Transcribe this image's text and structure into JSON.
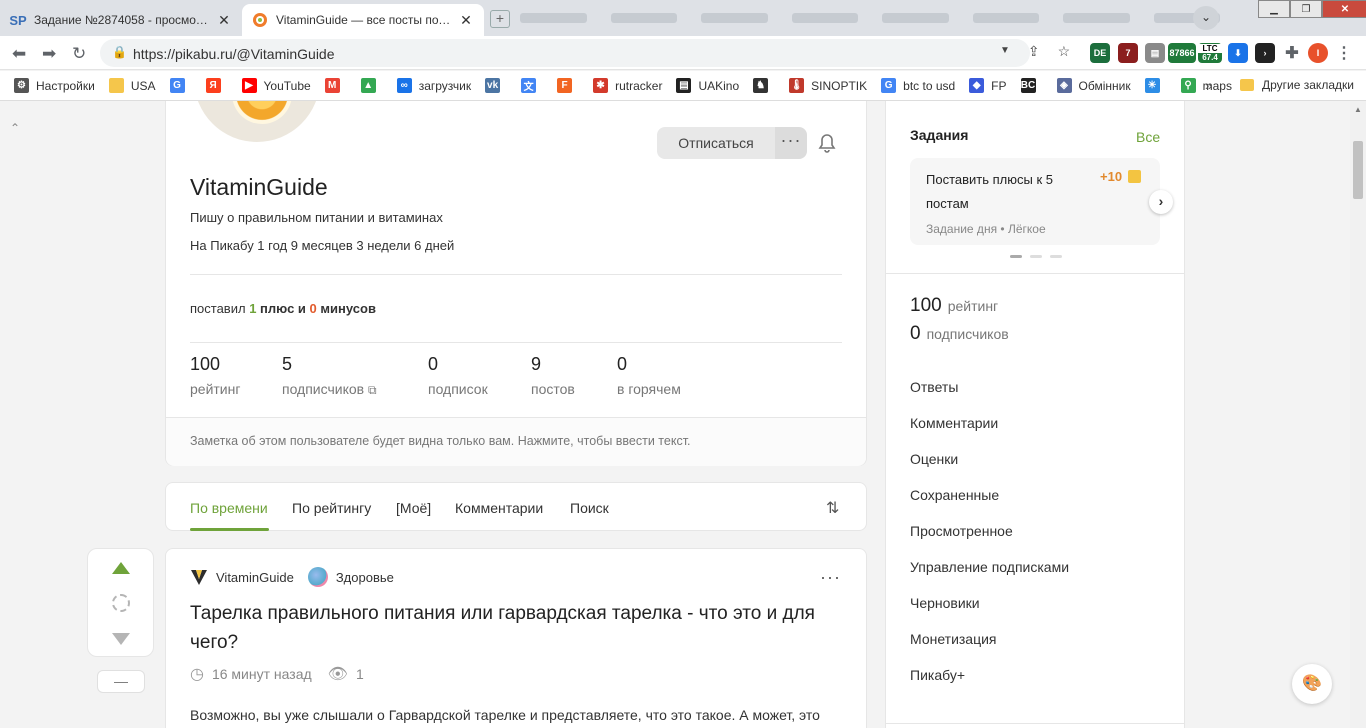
{
  "browser": {
    "tabs": [
      {
        "favicon": "SP",
        "title": "Задание №2874058 - просмотр з"
      },
      {
        "favicon": "pikabu-icon",
        "title": "VitaminGuide — все посты польз"
      }
    ],
    "url": "https://pikabu.ru/@VitaminGuide",
    "extensions": {
      "ltc": "LTC",
      "ltc_value": "67.4",
      "btc_value": "87866"
    },
    "profile_initial": "I",
    "bookmarks": [
      {
        "label": "Настройки",
        "icon": "gear-icon",
        "color": "#555555"
      },
      {
        "label": "USA",
        "icon": "folder-icon",
        "color": "#f5c64b"
      },
      {
        "label": "",
        "icon": "google-icon",
        "color": "#4285f4"
      },
      {
        "label": "",
        "icon": "yandex-icon",
        "color": "#fc3f1d"
      },
      {
        "label": "YouTube",
        "icon": "youtube-icon",
        "color": "#ff0000"
      },
      {
        "label": "",
        "icon": "gmail-icon",
        "color": "#ea4335"
      },
      {
        "label": "",
        "icon": "drive-icon",
        "color": "#34a853"
      },
      {
        "label": "загрузчик",
        "icon": "loop-icon",
        "color": "#1a73e8"
      },
      {
        "label": "",
        "icon": "vk-icon",
        "color": "#4c75a3"
      },
      {
        "label": "",
        "icon": "translate-icon",
        "color": "#4285f4"
      },
      {
        "label": "",
        "icon": "f-icon",
        "color": "#f26522"
      },
      {
        "label": "rutracker",
        "icon": "rutracker-icon",
        "color": "#d33a2c"
      },
      {
        "label": "UAKino",
        "icon": "uakino-icon",
        "color": "#222222"
      },
      {
        "label": "",
        "icon": "chess-icon",
        "color": "#333333"
      },
      {
        "label": "SINOPTIK",
        "icon": "thermometer-icon",
        "color": "#c0392b"
      },
      {
        "label": "btc to usd",
        "icon": "google-icon",
        "color": "#4285f4"
      },
      {
        "label": "FP",
        "icon": "fp-icon",
        "color": "#3b5bdb"
      },
      {
        "label": "",
        "icon": "bc-icon",
        "color": "#222222"
      },
      {
        "label": "Обмінник",
        "icon": "exchange-icon",
        "color": "#5a6b9c"
      },
      {
        "label": "",
        "icon": "snowflake-icon",
        "color": "#2d8de6"
      },
      {
        "label": "maps",
        "icon": "maps-icon",
        "color": "#34a853"
      }
    ],
    "bookmarks_more": "»",
    "other_bookmarks": "Другие закладки"
  },
  "profile": {
    "unsubscribe_label": "Отписаться",
    "name": "VitaminGuide",
    "description": "Пишу о правильном питании и витаминах",
    "joined": "На Пикабу 1 год 9 месяцев 3 недели 6 дней",
    "votes": {
      "prefix": "поставил",
      "plus_count": "1",
      "plus_label": "плюс и",
      "minus_count": "0",
      "minus_label": "минусов"
    },
    "stats": [
      {
        "value": "100",
        "label": "рейтинг"
      },
      {
        "value": "5",
        "label": "подписчиков"
      },
      {
        "value": "0",
        "label": "подписок"
      },
      {
        "value": "9",
        "label": "постов"
      },
      {
        "value": "0",
        "label": "в горячем"
      }
    ],
    "note": "Заметка об этом пользователе будет видна только вам. Нажмите, чтобы ввести текст."
  },
  "post_tabs": [
    {
      "label": "По времени",
      "active": true
    },
    {
      "label": "По рейтингу",
      "active": false
    },
    {
      "label": "[Моё]",
      "active": false
    },
    {
      "label": "Комментарии",
      "active": false
    },
    {
      "label": "Поиск",
      "active": false
    }
  ],
  "post": {
    "author": "VitaminGuide",
    "category": "Здоровье",
    "title": "Тарелка правильного питания или гарвардская тарелка - что это и для чего?",
    "time": "16 минут назад",
    "views": "1",
    "text": "Возможно, вы уже слышали о Гарвардской тарелке и представляете, что это такое. А может, это",
    "vote_minus": "—"
  },
  "sidebar": {
    "tasks_title": "Задания",
    "tasks_all": "Все",
    "task": {
      "title": "Поставить плюсы к 5 постам",
      "points": "+10",
      "type": "Задание дня",
      "difficulty": "Лёгкое",
      "separator": "•"
    },
    "rating_value": "100",
    "rating_label": "рейтинг",
    "subs_value": "0",
    "subs_label": "подписчиков",
    "menu": [
      "Ответы",
      "Комментарии",
      "Оценки",
      "Сохраненные",
      "Просмотренное",
      "Управление подписками",
      "Черновики",
      "Монетизация",
      "Пикабу+"
    ]
  },
  "colors": {
    "accent": "#6fa33a",
    "minus": "#e25b2d",
    "points": "#e2892d"
  }
}
